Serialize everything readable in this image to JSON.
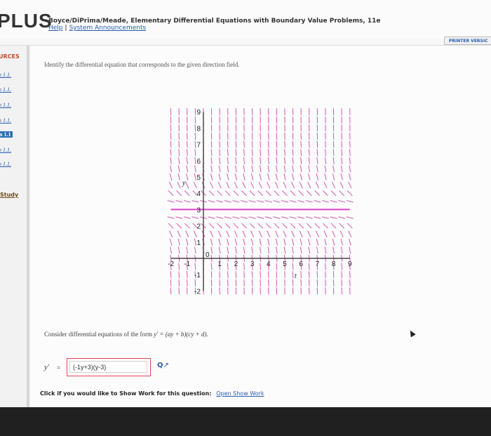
{
  "app": {
    "logo": "PLUS",
    "book_title": "Boyce/DiPrima/Meade, Elementary Differential Equations with Boundary Value Problems, 11e",
    "help_link": "Help",
    "separator": "|",
    "announcements_link": "System Announcements",
    "printer_version": "PRINTER VERSIC"
  },
  "sidebar": {
    "resources_label": "URCES",
    "items": [
      {
        "label": "n 1.1."
      },
      {
        "label": "n 1.1."
      },
      {
        "label": "n 1.1."
      },
      {
        "label": "n 1.1."
      },
      {
        "label": "n 1.1",
        "active": true
      },
      {
        "label": "n 1.1."
      },
      {
        "label": "n 1.1."
      }
    ],
    "study_label": "Study"
  },
  "question": {
    "prompt": "Identify the differential equation that corresponds to the given direction field.",
    "consider": "Consider differential equations of the form",
    "form": "y′ = (ay + b)(cy + d).",
    "answer_label": "y′",
    "equals": "=",
    "answer_value": "(-1y+3)(y-3)",
    "show_work_prompt": "Click if you would like to Show Work for this question:",
    "show_work_link": "Open Show Work"
  },
  "chart_data": {
    "type": "direction_field",
    "equilibrium_y": 3,
    "equilibrium_color": "#e040c8",
    "segment_color": "#cc3aa8",
    "axis_color": "#222222",
    "xlim": [
      -2,
      9
    ],
    "ylim": [
      -2,
      9
    ],
    "x_ticks": [
      "-2",
      "-1",
      "1",
      "2",
      "3",
      "4",
      "5",
      "6",
      "7",
      "8",
      "9"
    ],
    "y_ticks": [
      "9",
      "8",
      "7",
      "6",
      "5",
      "4",
      "3",
      "2",
      "1",
      "-1",
      "-2"
    ],
    "origin_label": "0",
    "xlabel": "t",
    "ylabel": "y"
  }
}
